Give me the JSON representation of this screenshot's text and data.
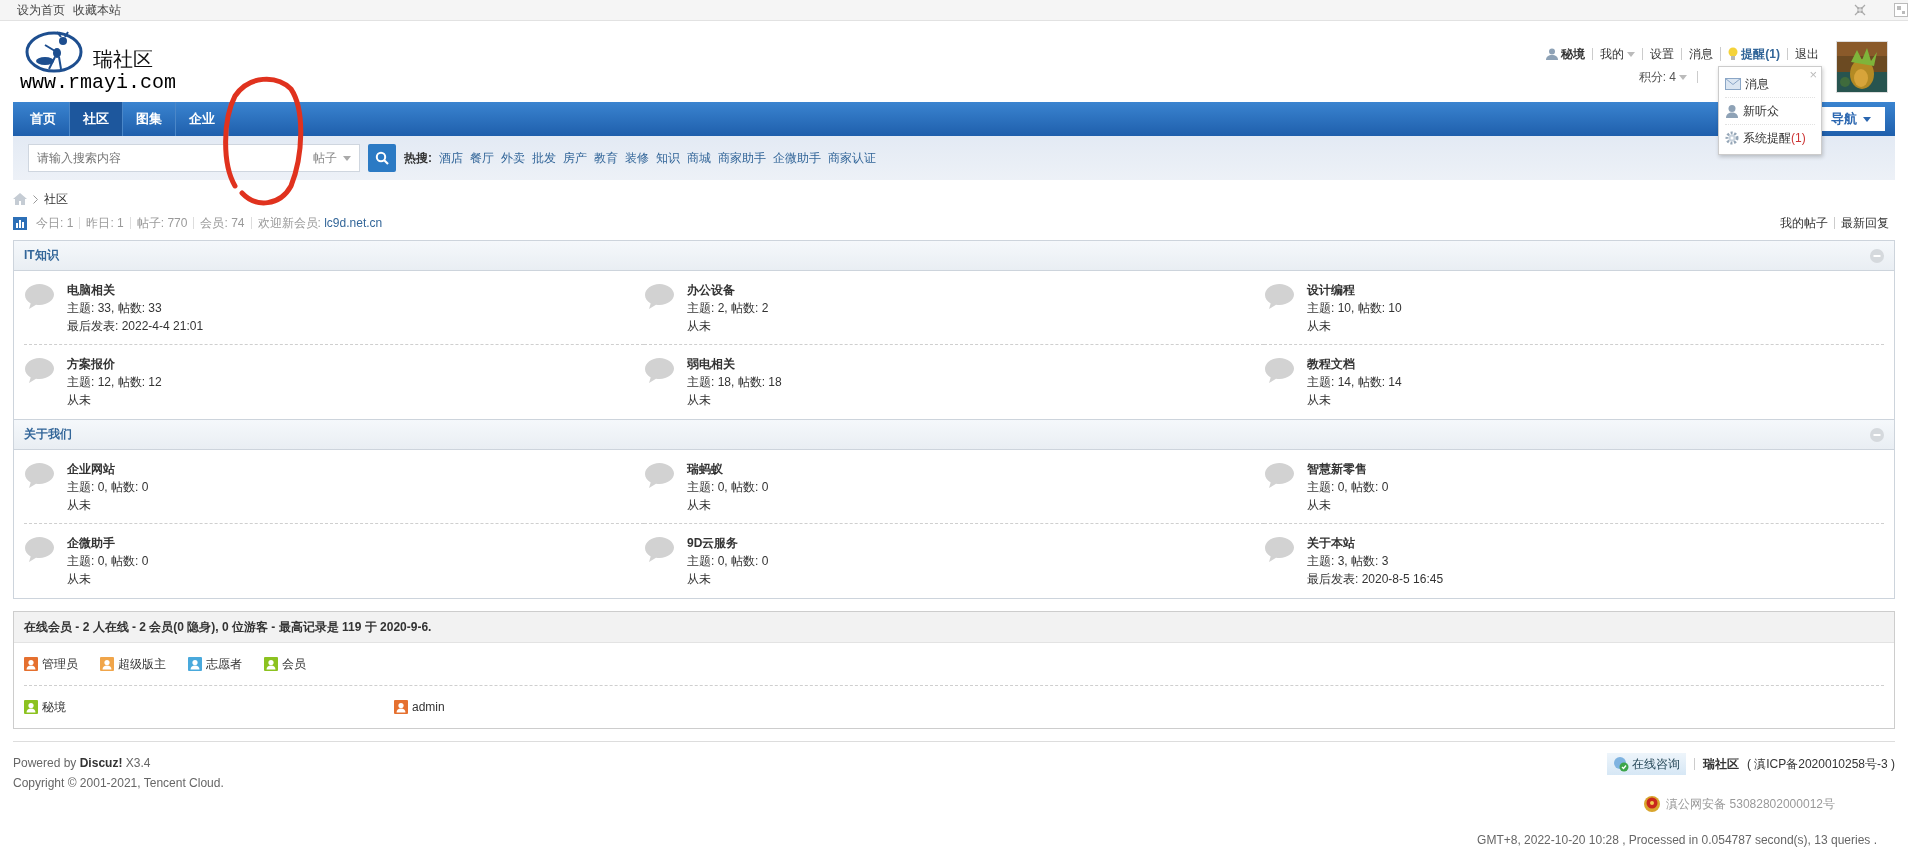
{
  "top_bar": {
    "links": [
      "设为首页",
      "收藏本站"
    ]
  },
  "logo": {
    "name": "瑞社区",
    "url": "www.rmayi.com"
  },
  "user_bar": {
    "username": "秘境",
    "links": [
      {
        "label": "我的",
        "kind": "menu"
      },
      {
        "label": "设置",
        "kind": "link"
      },
      {
        "label": "消息",
        "kind": "link"
      },
      {
        "label": "提醒(1)",
        "kind": "alert"
      },
      {
        "label": "退出",
        "kind": "link"
      }
    ],
    "credits": "积分: 4"
  },
  "notice_popup": {
    "close": "×",
    "items": [
      {
        "label": "消息",
        "kind": "mail"
      },
      {
        "label": "新听众",
        "kind": "person"
      },
      {
        "label": "系统提醒",
        "count": "(1)",
        "kind": "gear"
      }
    ]
  },
  "nav": {
    "tabs": [
      {
        "label": "首页",
        "selected": false
      },
      {
        "label": "社区",
        "selected": true
      },
      {
        "label": "图集",
        "selected": false
      },
      {
        "label": "企业",
        "selected": false
      }
    ],
    "quick_nav": "导航"
  },
  "search": {
    "placeholder": "请输入搜索内容",
    "scope": "帖子",
    "hot_label": "热搜:",
    "hot_words": [
      "酒店",
      "餐厅",
      "外卖",
      "批发",
      "房产",
      "教育",
      "装修",
      "知识",
      "商城",
      "商家助手",
      "企微助手",
      "商家认证"
    ]
  },
  "breadcrumb": [
    "社区"
  ],
  "stats": [
    {
      "label": "今日:",
      "value": "1"
    },
    {
      "label": "昨日:",
      "value": "1"
    },
    {
      "label": "帖子:",
      "value": "770"
    },
    {
      "label": "会员:",
      "value": "74"
    }
  ],
  "new_member": {
    "label": "欢迎新会员:",
    "name": "lc9d.net.cn"
  },
  "stats_links": [
    "我的帖子",
    "最新回复"
  ],
  "categories": [
    {
      "title": "IT知识",
      "forums": [
        {
          "name": "电脑相关",
          "counts": "主题: 33, 帖数: 33",
          "last": "最后发表: 2022-4-4 21:01"
        },
        {
          "name": "办公设备",
          "counts": "主题: 2, 帖数: 2",
          "last": "从未"
        },
        {
          "name": "设计编程",
          "counts": "主题: 10, 帖数: 10",
          "last": "从未"
        },
        {
          "name": "方案报价",
          "counts": "主题: 12, 帖数: 12",
          "last": "从未"
        },
        {
          "name": "弱电相关",
          "counts": "主题: 18, 帖数: 18",
          "last": "从未"
        },
        {
          "name": "教程文档",
          "counts": "主题: 14, 帖数: 14",
          "last": "从未"
        }
      ]
    },
    {
      "title": "关于我们",
      "forums": [
        {
          "name": "企业网站",
          "counts": "主题: 0, 帖数: 0",
          "last": "从未"
        },
        {
          "name": "瑞蚂蚁",
          "counts": "主题: 0, 帖数: 0",
          "last": "从未"
        },
        {
          "name": "智慧新零售",
          "counts": "主题: 0, 帖数: 0",
          "last": "从未"
        },
        {
          "name": "企微助手",
          "counts": "主题: 0, 帖数: 0",
          "last": "从未"
        },
        {
          "name": "9D云服务",
          "counts": "主题: 0, 帖数: 0",
          "last": "从未"
        },
        {
          "name": "关于本站",
          "counts": "主题: 3, 帖数: 3",
          "last": "最后发表: 2020-8-5 16:45"
        }
      ]
    }
  ],
  "online": {
    "title": "在线会员 - 2 人在线 - 2 会员(0 隐身), 0 位游客 - 最高记录是 119 于 2020-9-6.",
    "legend": [
      {
        "label": "管理员",
        "color": "#e5702f"
      },
      {
        "label": "超级版主",
        "color": "#f0a54a"
      },
      {
        "label": "志愿者",
        "color": "#49a9dc"
      },
      {
        "label": "会员",
        "color": "#8cc220"
      }
    ],
    "members": [
      {
        "name": "秘境",
        "color": "#8cc220"
      },
      {
        "name": "admin",
        "color": "#e5702f"
      }
    ]
  },
  "footer": {
    "powered": "Powered by **Discuz!** X3.4",
    "copyright": "Copyright © 2001-2021, Tencent Cloud.",
    "consult": "在线咨询",
    "site": "瑞社区",
    "icp": "( 滇ICP备2020010258号-3 )",
    "police": "滇公网安备 53082802000012号",
    "stats": "GMT+8, 2022-10-20 10:28 , Processed in 0.054787 second(s), 13 queries ."
  }
}
